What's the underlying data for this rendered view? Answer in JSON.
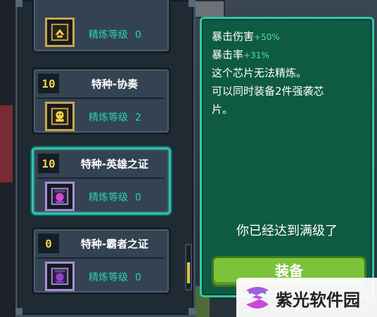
{
  "chips": [
    {
      "level": "",
      "name": "",
      "refine_label": "精炼等级",
      "refine_value": "0",
      "icon": "bird-chip-icon",
      "selected": false
    },
    {
      "level": "10",
      "name": "特种-协奏",
      "refine_label": "精炼等级",
      "refine_value": "2",
      "icon": "mask-chip-icon",
      "selected": false
    },
    {
      "level": "10",
      "name": "特种-英雄之证",
      "refine_label": "精炼等级",
      "refine_value": "0",
      "icon": "hero-chip-icon",
      "selected": true
    },
    {
      "level": "0",
      "name": "特种-霸者之证",
      "refine_label": "精炼等级",
      "refine_value": "0",
      "icon": "overlord-chip-icon",
      "selected": false
    }
  ],
  "detail": {
    "crit_damage_label": "暴击伤害",
    "crit_damage_bonus": "+50%",
    "crit_rate_label": "暴击率",
    "crit_rate_bonus": "+31%",
    "line_cannot_refine": "这个芯片无法精炼。",
    "line_equip_limit_1": "可以同时装备2件强袭芯",
    "line_equip_limit_2": "片。",
    "maxed_text": "你已经达到满级了",
    "equip_button": "装备"
  },
  "watermark": {
    "text": "紫光软件园"
  },
  "colors": {
    "accent_teal": "#2cc9a8",
    "level_yellow": "#f2d24a",
    "refine_teal": "#2bd2b3",
    "bonus_green": "#4ee39a",
    "equip_green": "#7cc33a"
  }
}
